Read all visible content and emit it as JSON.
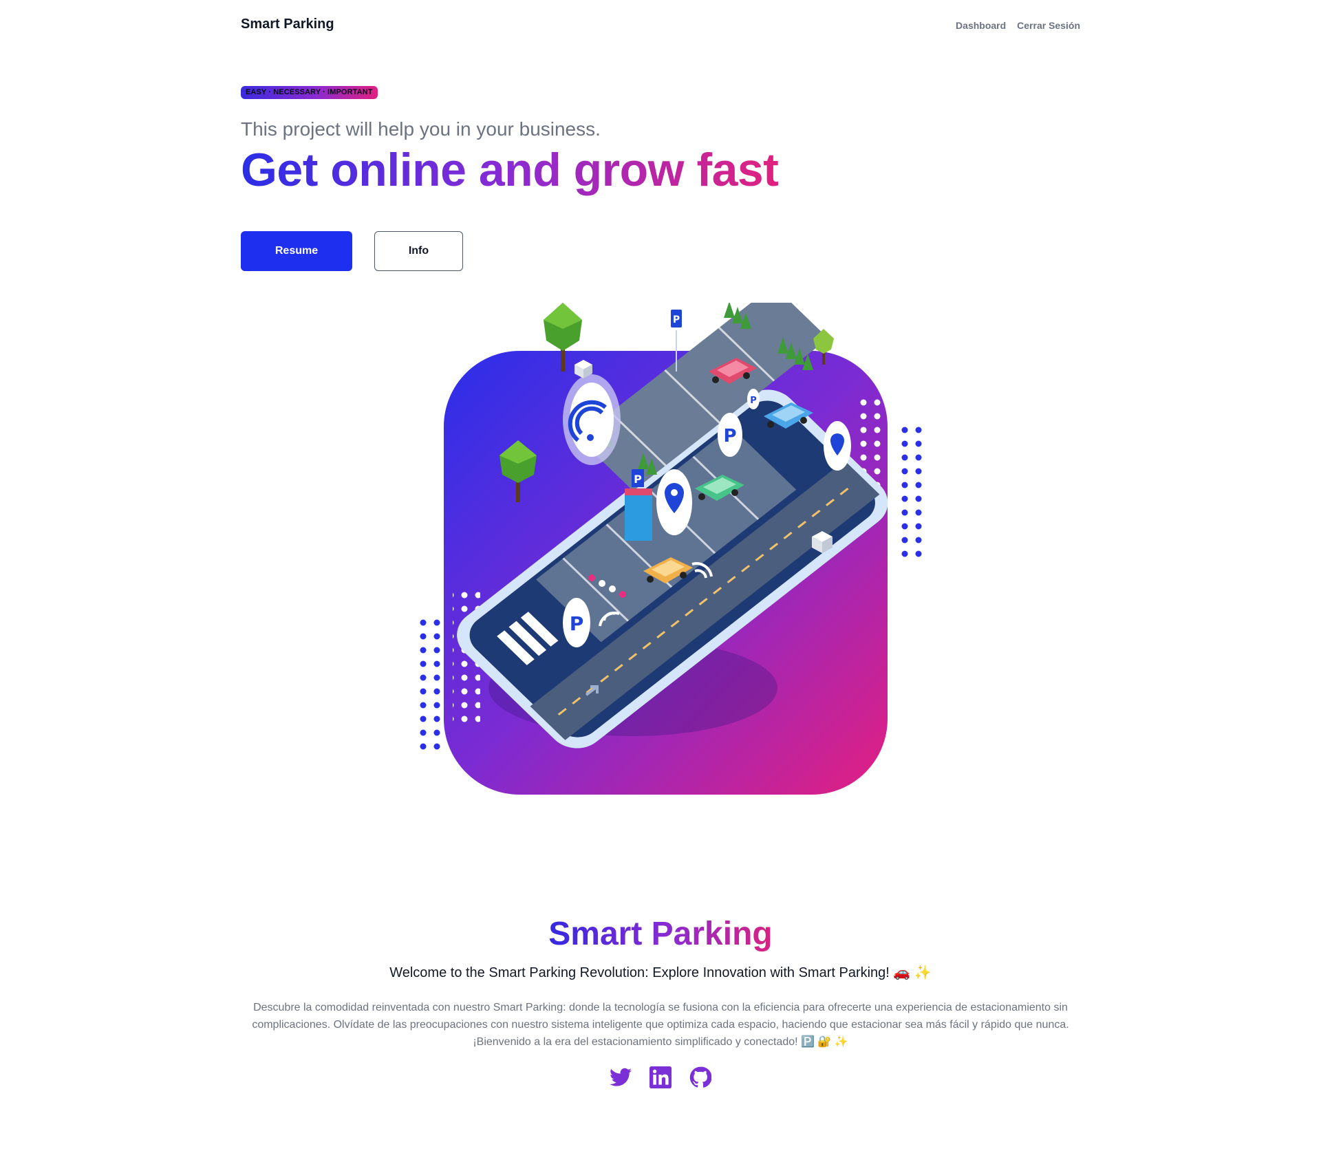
{
  "nav": {
    "brand": "Smart Parking",
    "links": [
      "Dashboard",
      "Cerrar Sesión"
    ]
  },
  "hero": {
    "badge": "EASY · NECESSARY · IMPORTANT",
    "subtitle": "This project will help you in your business.",
    "headline": "Get online and grow fast",
    "primary_button": "Resume",
    "secondary_button": "Info"
  },
  "illustration": {
    "parking_sign": "P",
    "icons": [
      "wifi-icon",
      "parking-pin-icon",
      "location-pin-icon",
      "car-icon",
      "tree-icon"
    ]
  },
  "footer": {
    "title": "Smart Parking",
    "subtitle": "Welcome to the Smart Parking Revolution: Explore Innovation with Smart Parking! 🚗 ✨",
    "description": "Descubre la comodidad reinventada con nuestro Smart Parking: donde la tecnología se fusiona con la eficiencia para ofrecerte una experiencia de estacionamiento sin complicaciones. Olvídate de las preocupaciones con nuestro sistema inteligente que optimiza cada espacio, haciendo que estacionar sea más fácil y rápido que nunca. ¡Bienvenido a la era del estacionamiento simplificado y conectado! 🅿️ 🔐 ✨",
    "socials": [
      "twitter-icon",
      "linkedin-icon",
      "github-icon"
    ]
  },
  "colors": {
    "accent_blue": "#1e2fef",
    "gradient_start": "#2b2ee6",
    "gradient_mid": "#8a2bd3",
    "gradient_end": "#e0217f",
    "muted_text": "#6b7280"
  }
}
